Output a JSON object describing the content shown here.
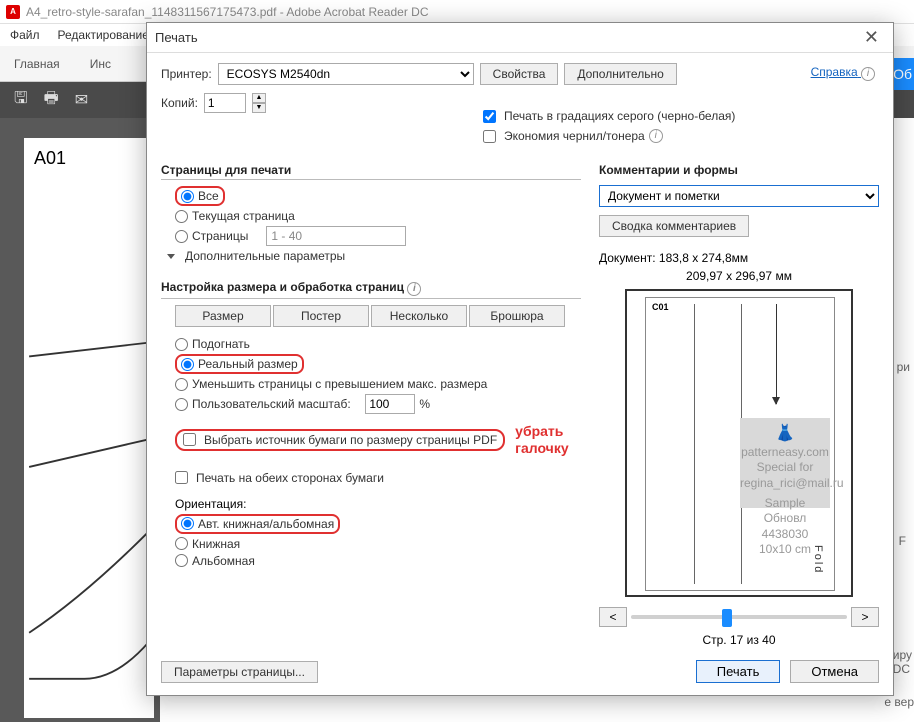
{
  "app": {
    "title": "A4_retro-style-sarafan_1148311567175473.pdf - Adobe Acrobat Reader DC",
    "menu": {
      "file": "Файл",
      "edit": "Редактирование"
    },
    "tabs": {
      "home": "Главная",
      "tools_partial": "Инс"
    },
    "doc_corner_label": "A01",
    "signin_partial": "Об"
  },
  "dialog": {
    "title": "Печать",
    "help": "Справка",
    "printer_label": "Принтер:",
    "printer_value": "ECOSYS M2540dn",
    "properties": "Свойства",
    "advanced": "Дополнительно",
    "copies_label": "Копий:",
    "copies_value": "1",
    "grayscale": "Печать в градациях серого (черно-белая)",
    "ink_save": "Экономия чернил/тонера",
    "pages": {
      "head": "Страницы для печати",
      "all": "Все",
      "current": "Текущая страница",
      "range_label": "Страницы",
      "range_value": "1 - 40",
      "more": "Дополнительные параметры"
    },
    "sizing": {
      "head": "Настройка размера и обработка страниц",
      "size": "Размер",
      "poster": "Постер",
      "multiple": "Несколько",
      "booklet": "Брошюра",
      "fit": "Подогнать",
      "actual": "Реальный размер",
      "shrink": "Уменьшить страницы с превышением макс. размера",
      "custom": "Пользовательский масштаб:",
      "custom_value": "100",
      "pct": "%",
      "paper_source": "Выбрать источник бумаги по размеру страницы PDF",
      "both_sides": "Печать на обеих сторонах бумаги"
    },
    "annotations": {
      "remove_check": "убрать галочку"
    },
    "orientation": {
      "head": "Ориентация:",
      "auto": "Авт. книжная/альбомная",
      "portrait": "Книжная",
      "landscape": "Альбомная"
    },
    "comments": {
      "head": "Комментарии и формы",
      "dropdown": "Документ и пометки",
      "summary": "Сводка комментариев"
    },
    "preview": {
      "doc_size": "Документ: 183,8 x 274,8мм",
      "paper_size": "209,97 x 296,97 мм",
      "corner": "C01",
      "fold": "Fold",
      "prev": "<",
      "next": ">",
      "page_of": "Стр. 17 из 40",
      "wm_line1": "patterneasy.com",
      "wm_line2": "Special for",
      "wm_line3": "regina_rici@mail.ru",
      "wm_line4": "Sample",
      "wm_line5": "Обновл 4438030",
      "wm_line6": "10x10 cm"
    },
    "footer": {
      "page_setup": "Параметры страницы...",
      "print": "Печать",
      "cancel": "Отмена"
    }
  },
  "bg_text": {
    "ri": "ри",
    "f": "F",
    "iru": "иру",
    "dc": "DC",
    "ver": "е вер"
  }
}
